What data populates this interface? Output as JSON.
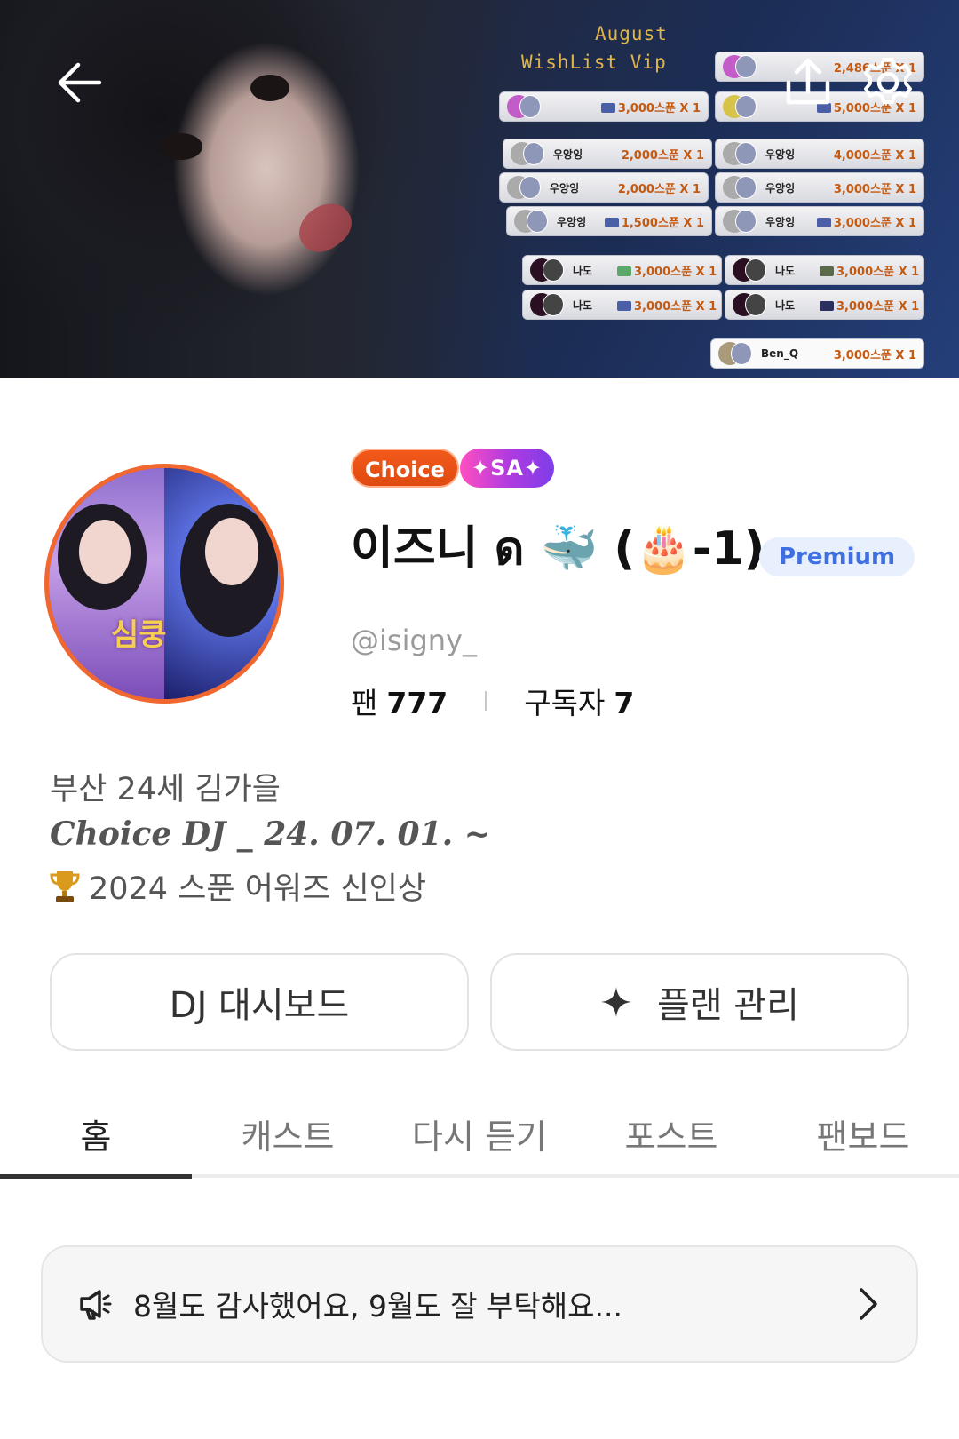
{
  "banner": {
    "wishlist_title_line1": "August",
    "wishlist_title_line2": "WishList Vip",
    "rows": [
      {
        "name": "",
        "amount": "2,486스푼 X 1"
      },
      {
        "name": "",
        "amount": "3,000스푼 X 1"
      },
      {
        "name": "",
        "amount": "5,000스푼 X 1"
      },
      {
        "name": "우앙잉",
        "amount": "2,000스푼 X 1"
      },
      {
        "name": "우앙잉",
        "amount": "4,000스푼 X 1"
      },
      {
        "name": "우앙잉",
        "amount": "2,000스푼 X 1"
      },
      {
        "name": "우앙잉",
        "amount": "3,000스푼 X 1"
      },
      {
        "name": "우앙잉",
        "amount": "1,500스푼 X 1"
      },
      {
        "name": "우앙잉",
        "amount": "3,000스푼 X 1"
      },
      {
        "name": "나도",
        "amount": "3,000스푼 X 1"
      },
      {
        "name": "나도",
        "amount": "3,000스푼 X 1"
      },
      {
        "name": "나도",
        "amount": "3,000스푼 X 1"
      },
      {
        "name": "나도",
        "amount": "3,000스푼 X 1"
      },
      {
        "name": "Ben_Q",
        "amount": "3,000스푼 X 1"
      }
    ]
  },
  "avatar_text": "심쿵",
  "profile": {
    "badge_choice": "Choice",
    "badge_sa": "✦SA✦",
    "name": "이즈니 ด 🐳 (🎂-1)",
    "premium_label": "Premium",
    "handle": "@isigny_",
    "fans_label": "팬",
    "fans_count": "777",
    "subscribers_label": "구독자",
    "subscribers_count": "7"
  },
  "bio": {
    "line1": "부산 24세 김가을",
    "line2": "Choice DJ _ 24. 07. 01. ~",
    "line3": "2024 스푼 어워즈 신인상"
  },
  "actions": {
    "dashboard_label": "DJ 대시보드",
    "plan_label": "플랜 관리"
  },
  "tabs": [
    {
      "label": "홈"
    },
    {
      "label": "캐스트"
    },
    {
      "label": "다시 듣기"
    },
    {
      "label": "포스트"
    },
    {
      "label": "팬보드"
    }
  ],
  "notice": {
    "text": "8월도 감사했어요, 9월도 잘 부탁해요..."
  },
  "colors": {
    "accent_orange": "#f0672f",
    "premium_blue": "#3f6fe0",
    "premium_bg": "#e8effd"
  },
  "icons": {
    "back": "back-arrow-icon",
    "share": "share-icon",
    "settings": "gear-icon",
    "plan": "sparkle-icon",
    "notice": "megaphone-icon",
    "chevron": "chevron-right-icon",
    "trophy": "trophy-icon"
  }
}
